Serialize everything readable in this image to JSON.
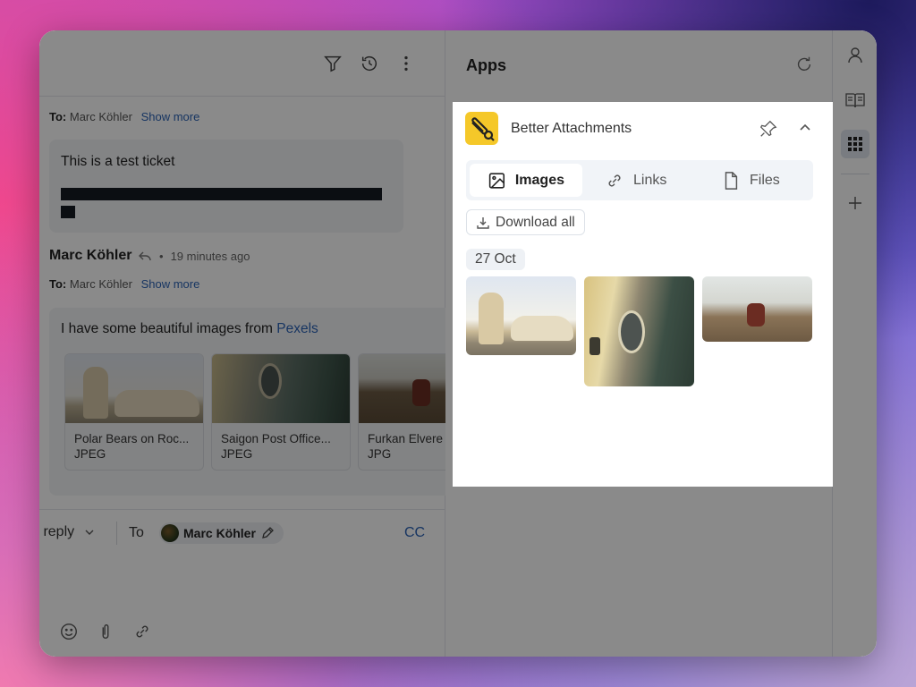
{
  "ticket_view": {
    "header_icons": [
      "filter-icon",
      "history-icon",
      "more-vertical-icon"
    ],
    "messages": [
      {
        "to_label": "To:",
        "to_name": "Marc Köhler",
        "show_more": "Show more",
        "body": "This is a test ticket",
        "redacted": true
      },
      {
        "sender": "Marc Köhler",
        "separator": "•",
        "time": "19 minutes ago",
        "to_label": "To:",
        "to_name": "Marc Köhler",
        "show_more": "Show more",
        "body_prefix": "I have some beautiful images from ",
        "body_link": "Pexels",
        "attachments": [
          {
            "name": "Polar Bears on Roc...",
            "type": "JPEG"
          },
          {
            "name": "Saigon Post Office...",
            "type": "JPEG"
          },
          {
            "name": "Furkan Elvere",
            "type": "JPG"
          }
        ]
      }
    ],
    "composer": {
      "reply_type": "c reply",
      "to_label": "To",
      "recipient": "Marc Köhler",
      "cc_label": "CC",
      "tool_icons": [
        "emoji-icon",
        "paperclip-icon",
        "link-icon"
      ]
    }
  },
  "apps_panel": {
    "title": "Apps",
    "app": {
      "name": "Better Attachments",
      "tabs": [
        {
          "label": "Images",
          "icon": "image-icon",
          "active": true
        },
        {
          "label": "Links",
          "icon": "link-icon",
          "active": false
        },
        {
          "label": "Files",
          "icon": "file-icon",
          "active": false
        }
      ],
      "download_all": "Download all",
      "groups": [
        {
          "date": "27 Oct",
          "images": [
            "Polar bears on rock",
            "Saigon Post Office facade",
            "Man seated by windows"
          ]
        }
      ]
    }
  },
  "right_rail": {
    "icons": [
      "user-icon",
      "book-icon",
      "apps-grid-icon",
      "plus-icon"
    ],
    "active": "apps-grid-icon"
  },
  "colors": {
    "accent_link": "#2b63b5",
    "app_logo": "#f5c829"
  }
}
